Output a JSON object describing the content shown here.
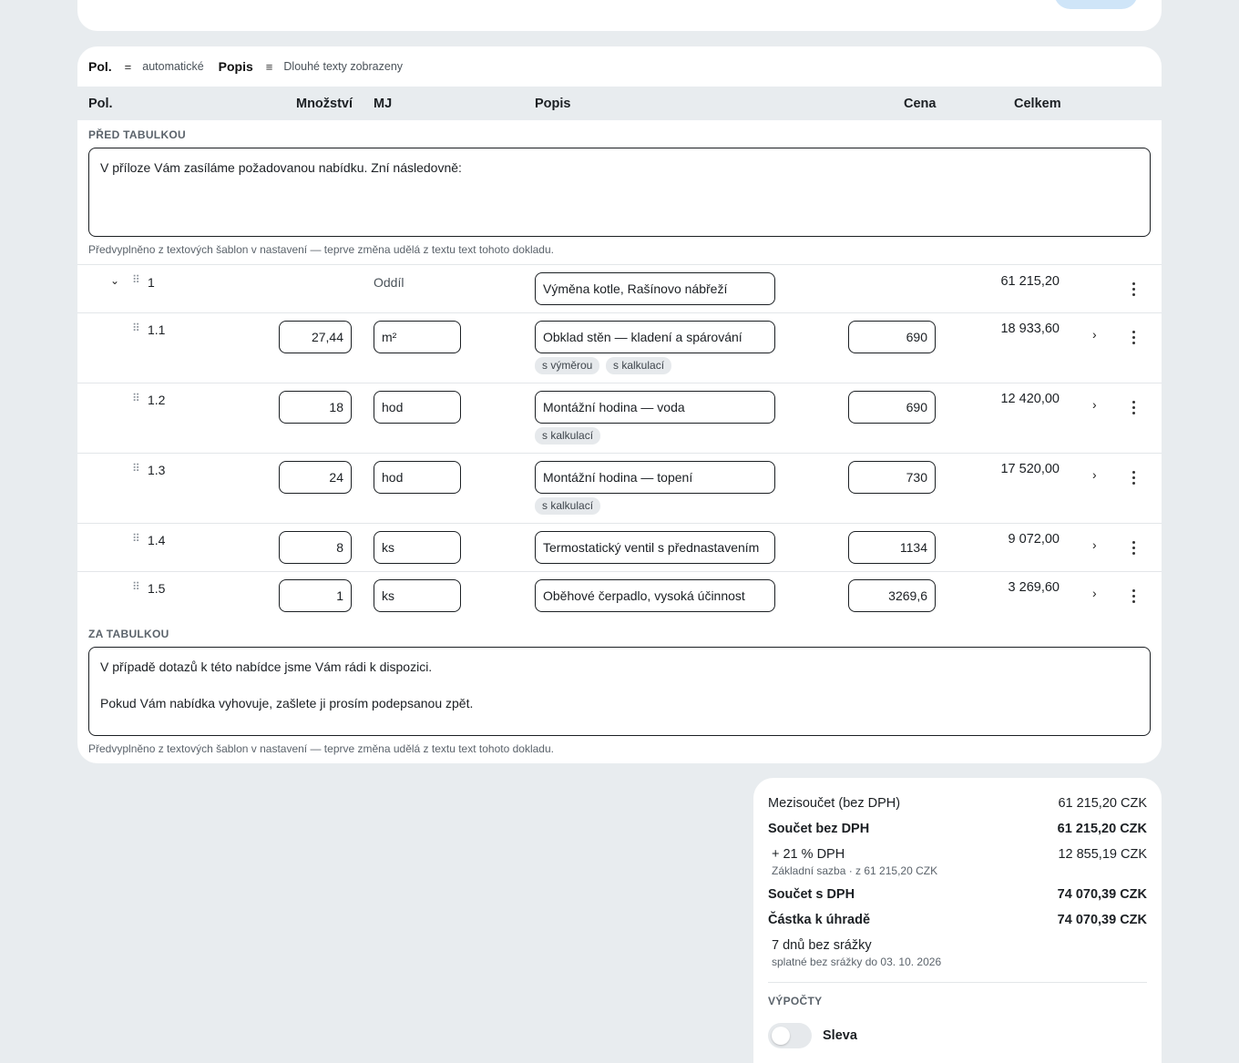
{
  "toolbar": {
    "pos_label": "Pol.",
    "pos_icon": "=",
    "pos_value": "automatické",
    "desc_label": "Popis",
    "desc_icon": "≡",
    "desc_value": "Dlouhé texty zobrazeny"
  },
  "table_header": {
    "pos": "Pol.",
    "qty": "Množství",
    "unit": "MJ",
    "desc": "Popis",
    "price": "Cena",
    "total": "Celkem"
  },
  "before_table": {
    "label": "PŘED TABULKOU",
    "text": "V příloze Vám zasíláme požadovanou nabídku. Zní následovně:",
    "hint": "Předvyplněno z textových šablon v nastavení — teprve změna udělá z textu text tohoto dokladu."
  },
  "section": {
    "pos": "1",
    "type": "Oddíl",
    "title": "Výměna kotle, Rašínovo nábřeží",
    "total": "61 215,20"
  },
  "items": [
    {
      "pos": "1.1",
      "qty": "27,44",
      "unit": "m²",
      "desc": "Obklad stěn — kladení a spárování",
      "price": "690",
      "total": "18 933,60",
      "tags": [
        "s výměrou",
        "s kalkulací"
      ]
    },
    {
      "pos": "1.2",
      "qty": "18",
      "unit": "hod",
      "desc": "Montážní hodina — voda",
      "price": "690",
      "total": "12 420,00",
      "tags": [
        "s kalkulací"
      ]
    },
    {
      "pos": "1.3",
      "qty": "24",
      "unit": "hod",
      "desc": "Montážní hodina — topení",
      "price": "730",
      "total": "17 520,00",
      "tags": [
        "s kalkulací"
      ]
    },
    {
      "pos": "1.4",
      "qty": "8",
      "unit": "ks",
      "desc": "Termostatický ventil s přednastavením",
      "price": "1134",
      "total": "9 072,00",
      "tags": []
    },
    {
      "pos": "1.5",
      "qty": "1",
      "unit": "ks",
      "desc": "Oběhové čerpadlo, vysoká účinnost",
      "price": "3269,6",
      "total": "3 269,60",
      "tags": []
    }
  ],
  "after_table": {
    "label": "ZA TABULKOU",
    "text_line1": "V případě dotazů k této nabídce jsme Vám rádi k dispozici.",
    "text_line2": "Pokud Vám nabídka vyhovuje, zašlete ji prosím podepsanou zpět.",
    "hint": "Předvyplněno z textových šablon v nastavení — teprve změna udělá z textu text tohoto dokladu."
  },
  "summary": {
    "subtotal_label": "Mezisoučet (bez DPH)",
    "subtotal_value": "61 215,20 CZK",
    "net_label": "Součet bez DPH",
    "net_value": "61 215,20 CZK",
    "vat_label": "+ 21 % DPH",
    "vat_value": "12 855,19 CZK",
    "vat_sub": "Základní sazba · z 61 215,20 CZK",
    "gross_label": "Součet s DPH",
    "gross_value": "74 070,39 CZK",
    "due_label": "Částka k úhradě",
    "due_value": "74 070,39 CZK",
    "terms_label": "7 dnů bez srážky",
    "terms_sub": "splatné bez srážky do 03. 10. 2026",
    "calc_label": "VÝPOČTY",
    "discount_label": "Sleva",
    "discount_enabled": false
  }
}
